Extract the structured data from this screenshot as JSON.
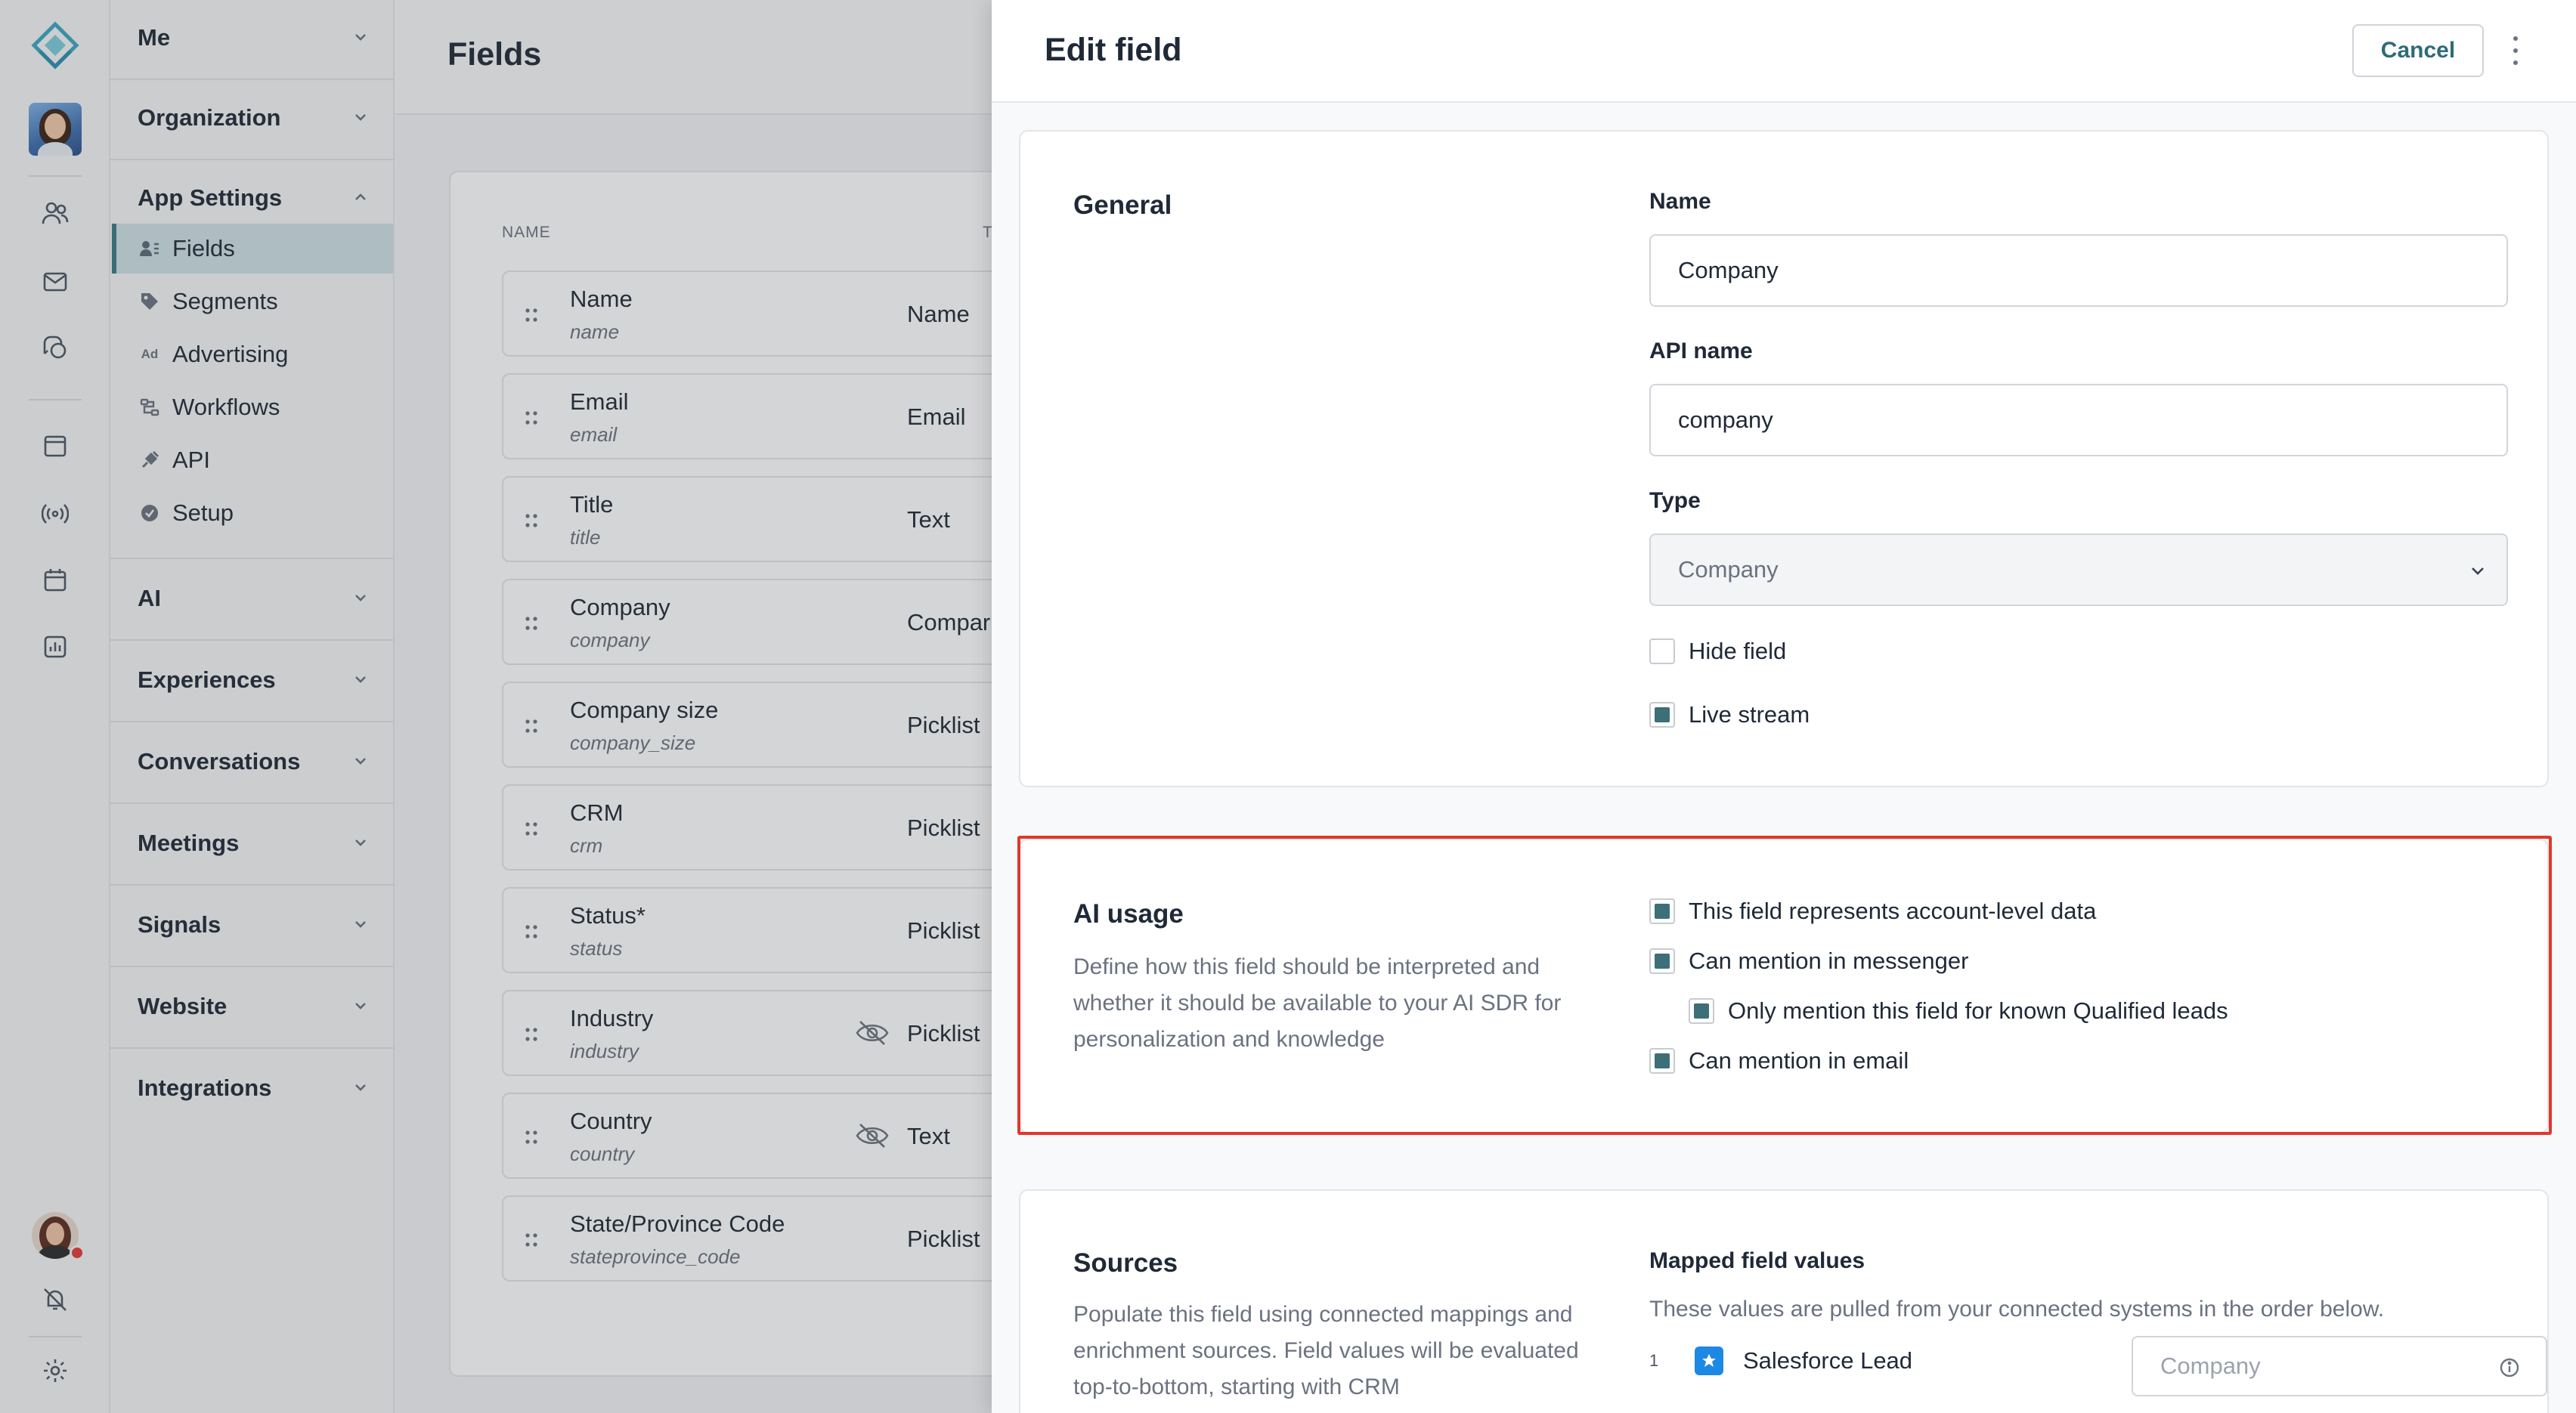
{
  "rail": {
    "icons": [
      "logo-icon",
      "user-avatar",
      "contacts-icon",
      "inbox-icon",
      "conversations-icon",
      "calendar-icon",
      "signals-icon",
      "meetings-icon",
      "analytics-icon",
      "profile-avatar",
      "notifications-off-icon",
      "settings-icon"
    ]
  },
  "nav": {
    "groups": [
      {
        "label": "Me"
      },
      {
        "label": "Organization"
      },
      {
        "label": "App Settings"
      },
      {
        "label": "AI"
      },
      {
        "label": "Experiences"
      },
      {
        "label": "Conversations"
      },
      {
        "label": "Meetings"
      },
      {
        "label": "Signals"
      },
      {
        "label": "Website"
      },
      {
        "label": "Integrations"
      }
    ],
    "app_settings_items": [
      {
        "label": "Fields",
        "icon": "fields-icon",
        "active": true
      },
      {
        "label": "Segments",
        "icon": "tag-icon"
      },
      {
        "label": "Advertising",
        "icon": "ad-icon"
      },
      {
        "label": "Workflows",
        "icon": "workflows-icon"
      },
      {
        "label": "API",
        "icon": "plug-icon"
      },
      {
        "label": "Setup",
        "icon": "check-circle-icon"
      }
    ]
  },
  "page": {
    "title": "Fields",
    "columns": {
      "name": "NAME",
      "type": "T"
    },
    "rows": [
      {
        "name": "Name",
        "api": "name",
        "type": "Name",
        "hidden": false
      },
      {
        "name": "Email",
        "api": "email",
        "type": "Email",
        "hidden": false
      },
      {
        "name": "Title",
        "api": "title",
        "type": "Text",
        "hidden": false
      },
      {
        "name": "Company",
        "api": "company",
        "type": "Compar",
        "hidden": false
      },
      {
        "name": "Company size",
        "api": "company_size",
        "type": "Picklist",
        "hidden": false
      },
      {
        "name": "CRM",
        "api": "crm",
        "type": "Picklist",
        "hidden": false
      },
      {
        "name": "Status*",
        "api": "status",
        "type": "Picklist",
        "hidden": false
      },
      {
        "name": "Industry",
        "api": "industry",
        "type": "Picklist",
        "hidden": true
      },
      {
        "name": "Country",
        "api": "country",
        "type": "Text",
        "hidden": true
      },
      {
        "name": "State/Province Code",
        "api": "stateprovince_code",
        "type": "Picklist",
        "hidden": false
      }
    ]
  },
  "drawer": {
    "title": "Edit field",
    "cancel_label": "Cancel",
    "general": {
      "title": "General",
      "name_label": "Name",
      "name_value": "Company",
      "api_label": "API name",
      "api_value": "company",
      "type_label": "Type",
      "type_value": "Company",
      "hide_field": {
        "label": "Hide field",
        "checked": false
      },
      "live_stream": {
        "label": "Live stream",
        "checked": true
      }
    },
    "ai_usage": {
      "title": "AI usage",
      "description": "Define how this field should be interpreted and whether it should be available to your AI SDR for personalization and knowledge",
      "options": [
        {
          "label": "This field represents account-level data",
          "checked": true
        },
        {
          "label": "Can mention in messenger",
          "checked": true
        },
        {
          "label": "Only mention this field for known Qualified leads",
          "checked": true
        },
        {
          "label": "Can mention in email",
          "checked": true
        }
      ]
    },
    "sources": {
      "title": "Sources",
      "description": "Populate this field using connected mappings and enrichment sources. Field values will be evaluated top-to-bottom, starting with CRM",
      "mapped_label": "Mapped field values",
      "mapped_hint": "These values are pulled from your connected systems in the order below.",
      "items": [
        {
          "index": "1",
          "source": "Salesforce Lead",
          "field_placeholder": "Company"
        }
      ]
    }
  },
  "colors": {
    "accent": "#3d6f78",
    "highlight": "#e0382c",
    "active_nav": "#cfe0e4"
  }
}
